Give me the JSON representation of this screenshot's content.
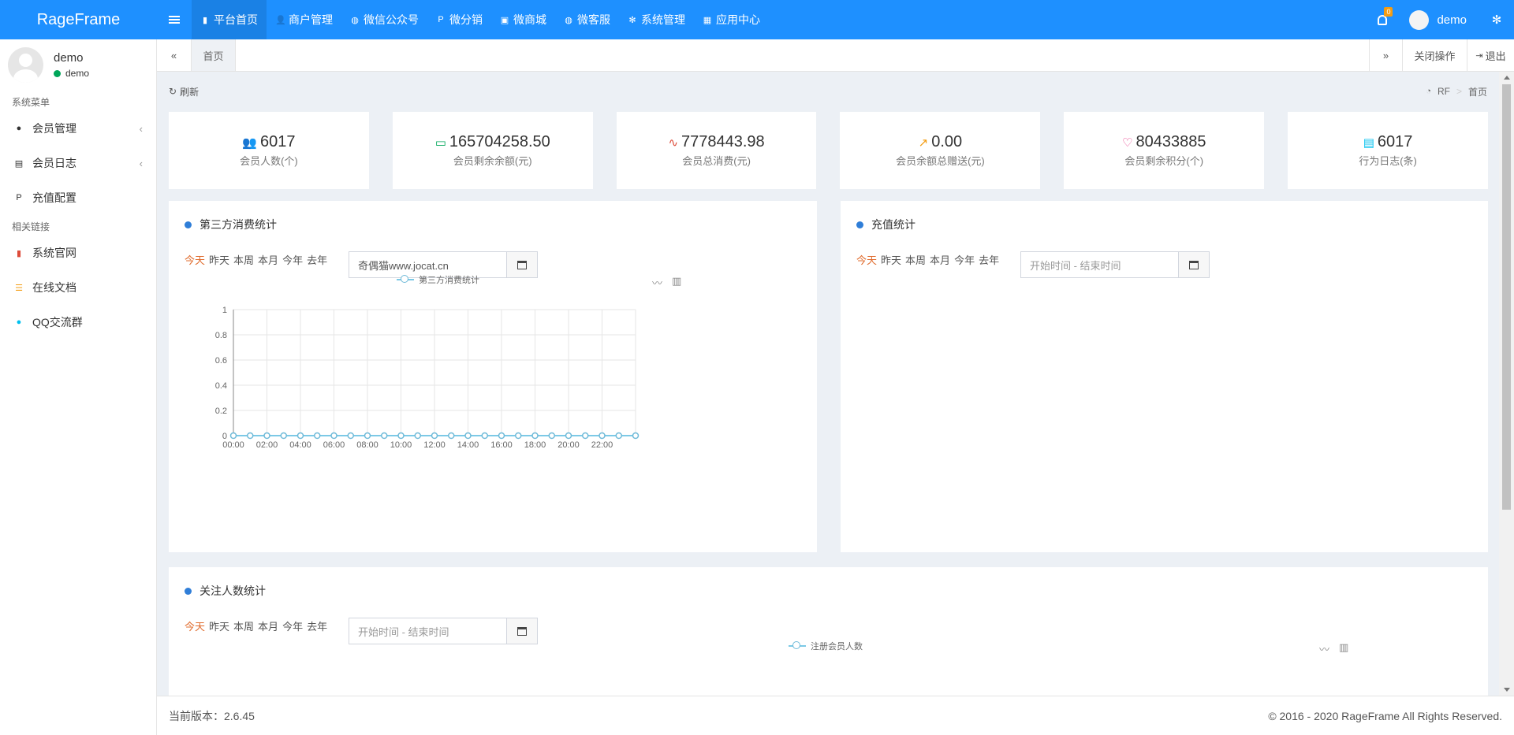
{
  "app": {
    "brand": "RageFrame"
  },
  "topnav": [
    {
      "label": "平台首页",
      "icon": "bookmark-icon",
      "glyph": "▮"
    },
    {
      "label": "商户管理",
      "icon": "user-plus-icon",
      "glyph": "👤"
    },
    {
      "label": "微信公众号",
      "icon": "wechat-icon",
      "glyph": "◍"
    },
    {
      "label": "微分销",
      "icon": "paypal-icon",
      "glyph": "P"
    },
    {
      "label": "微商城",
      "icon": "shopping-bag-icon",
      "glyph": "▣"
    },
    {
      "label": "微客服",
      "icon": "comments-icon",
      "glyph": "◍"
    },
    {
      "label": "系统管理",
      "icon": "cogs-icon",
      "glyph": "✻"
    },
    {
      "label": "应用中心",
      "icon": "windows-icon",
      "glyph": "▦"
    }
  ],
  "header": {
    "notifications": "0",
    "username": "demo"
  },
  "sidebar": {
    "user": {
      "name": "demo",
      "status": "demo"
    },
    "section1": "系统菜单",
    "items1": [
      {
        "label": "会员管理",
        "glyph": "●",
        "has_sub": true
      },
      {
        "label": "会员日志",
        "glyph": "▤",
        "has_sub": true
      },
      {
        "label": "充值配置",
        "glyph": "P",
        "has_sub": false
      }
    ],
    "section2": "相关链接",
    "items2": [
      {
        "label": "系统官网",
        "glyph": "▮",
        "color": "#dd4b39"
      },
      {
        "label": "在线文档",
        "glyph": "☰",
        "color": "#f39c12"
      },
      {
        "label": "QQ交流群",
        "glyph": "●",
        "color": "#00c0ef"
      }
    ]
  },
  "tabs": {
    "collapse_left": "«",
    "home": "首页",
    "collapse_right": "»",
    "close_ops": "关闭操作",
    "logout": "退出"
  },
  "crumbs": {
    "refresh": "刷新",
    "root": "RF",
    "current": "首页"
  },
  "stats": [
    {
      "value": "6017",
      "label": "会员人数(个)",
      "icon": "users-icon",
      "glyph": "👥",
      "color": "#3c8dbc"
    },
    {
      "value": "165704258.50",
      "label": "会员剩余余额(元)",
      "icon": "credit-card-icon",
      "glyph": "▭",
      "color": "#00a65a"
    },
    {
      "value": "7778443.98",
      "label": "会员总消费(元)",
      "icon": "heartbeat-icon",
      "glyph": "∿",
      "color": "#dd4b39"
    },
    {
      "value": "0.00",
      "label": "会员余额总赠送(元)",
      "icon": "trend-icon",
      "glyph": "↗",
      "color": "#f39c12"
    },
    {
      "value": "80433885",
      "label": "会员剩余积分(个)",
      "icon": "lightbulb-icon",
      "glyph": "♡",
      "color": "#e83e8c"
    },
    {
      "value": "6017",
      "label": "行为日志(条)",
      "icon": "list-alt-icon",
      "glyph": "▤",
      "color": "#00c0ef"
    }
  ],
  "filter_options": [
    "今天",
    "昨天",
    "本周",
    "本月",
    "今年",
    "去年"
  ],
  "panel1": {
    "title": "第三方消费统计",
    "date_value": "奇偶猫www.jocat.cn",
    "legend": "第三方消费统计"
  },
  "panel2": {
    "title": "充值统计",
    "date_placeholder": "开始时间 - 结束时间"
  },
  "panel3": {
    "title": "关注人数统计",
    "date_placeholder": "开始时间 - 结束时间",
    "legend": "注册会员人数"
  },
  "footer": {
    "version": "当前版本：2.6.45",
    "copyright": "© 2016 - 2020 RageFrame All Rights Reserved."
  },
  "chart_data": {
    "type": "line",
    "title": "",
    "series": [
      {
        "name": "第三方消费统计",
        "values": [
          0,
          0,
          0,
          0,
          0,
          0,
          0,
          0,
          0,
          0,
          0,
          0,
          0,
          0,
          0,
          0,
          0,
          0,
          0,
          0,
          0,
          0,
          0,
          0
        ]
      }
    ],
    "x": [
      "00:00",
      "01:00",
      "02:00",
      "03:00",
      "04:00",
      "05:00",
      "06:00",
      "07:00",
      "08:00",
      "09:00",
      "10:00",
      "11:00",
      "12:00",
      "13:00",
      "14:00",
      "15:00",
      "16:00",
      "17:00",
      "18:00",
      "19:00",
      "20:00",
      "21:00",
      "22:00",
      "23:00"
    ],
    "x_tick_labels": [
      "00:00",
      "02:00",
      "04:00",
      "06:00",
      "08:00",
      "10:00",
      "12:00",
      "14:00",
      "16:00",
      "18:00",
      "20:00",
      "22:00"
    ],
    "y_ticks": [
      "0",
      "0.2",
      "0.4",
      "0.6",
      "0.8",
      "1"
    ],
    "ylim": [
      0,
      1
    ],
    "grid": true,
    "legend_position": "top-center",
    "line_color": "#7cc9e6"
  }
}
